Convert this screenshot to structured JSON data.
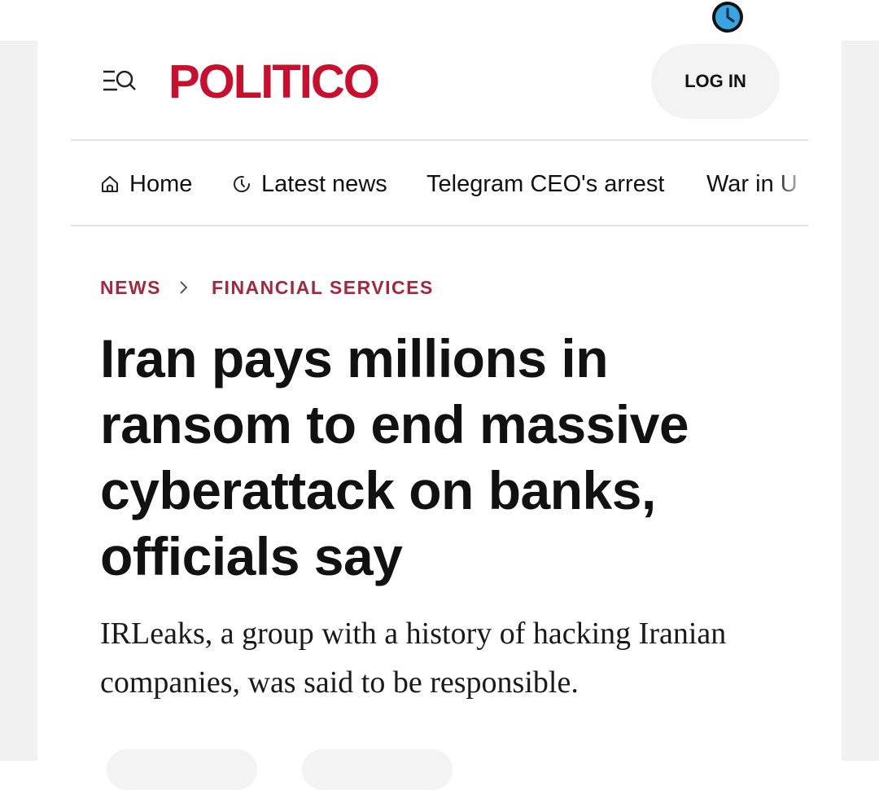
{
  "status_bar": {
    "icon": "clock-icon",
    "icon_color": "#3aa3e3"
  },
  "header": {
    "logo": "POLITICO",
    "login_label": "LOG IN",
    "brand_color": "#c8102e",
    "menu_icon": "menu-search-icon"
  },
  "nav": {
    "items": [
      {
        "label": "Home",
        "icon": "home-icon"
      },
      {
        "label": "Latest news",
        "icon": "clock-icon"
      },
      {
        "label": "Telegram CEO's arrest"
      },
      {
        "label": "War in U"
      }
    ]
  },
  "article": {
    "breadcrumb": [
      "NEWS",
      "FINANCIAL SERVICES"
    ],
    "breadcrumb_color": "#a3283e",
    "headline": "Iran pays millions in ransom to end massive cyberattack on banks, officials say",
    "dek": "IRLeaks, a group with a history of hacking Iranian companies, was said to be responsible."
  }
}
